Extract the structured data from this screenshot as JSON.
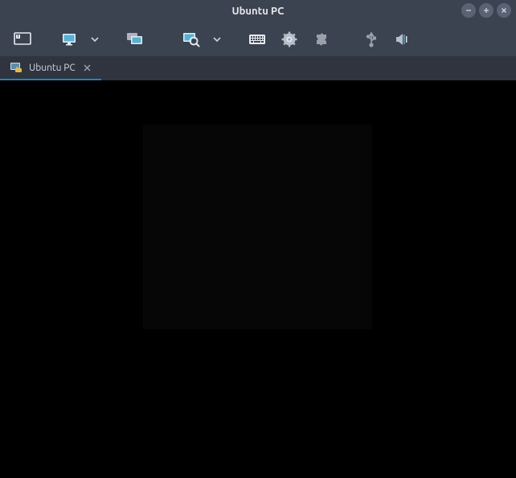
{
  "window": {
    "title": "Ubuntu PC"
  },
  "tab": {
    "label": "Ubuntu PC"
  },
  "icons": {
    "connections": "connections",
    "monitor": "monitor",
    "multi_monitor": "multi-monitor",
    "zoom": "zoom",
    "keyboard": "keyboard",
    "settings": "settings",
    "plugins": "plugins",
    "usb": "usb",
    "sound": "sound"
  }
}
